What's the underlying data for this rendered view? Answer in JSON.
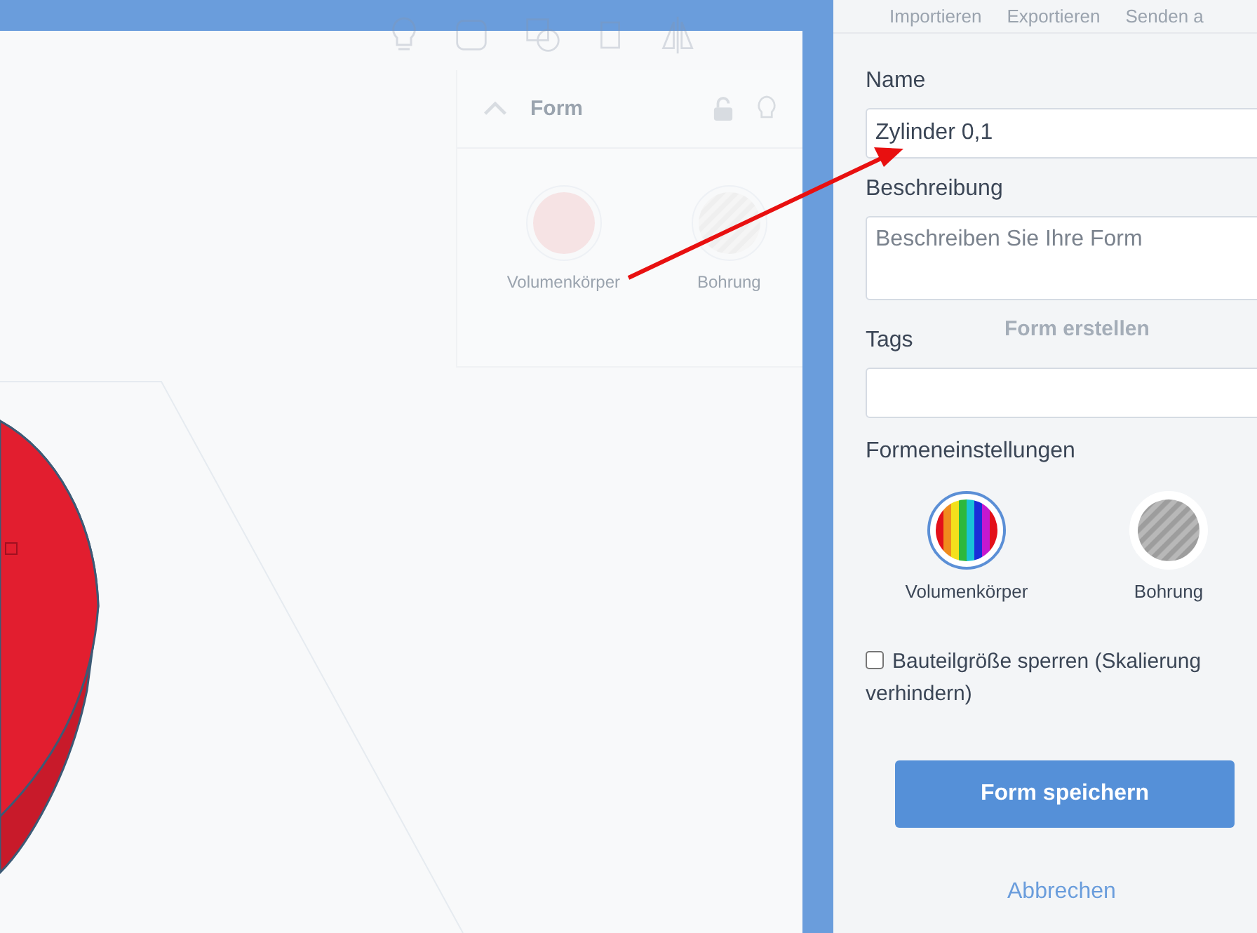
{
  "top_menu": [
    "Importieren",
    "Exportieren",
    "Senden a"
  ],
  "shape_panel": {
    "title": "Form",
    "shape_types": [
      {
        "label": "Volumenkörper",
        "kind": "solid"
      },
      {
        "label": "Bohrung",
        "kind": "hole"
      }
    ]
  },
  "background_button": "Form erstellen",
  "dialog": {
    "name": {
      "label": "Name",
      "value": "Zylinder 0,1"
    },
    "description": {
      "label": "Beschreibung",
      "placeholder": "Beschreiben Sie Ihre Form"
    },
    "tags": {
      "label": "Tags"
    },
    "shape_settings": {
      "label": "Formeneinstellungen",
      "options": [
        {
          "label": "Volumenkörper",
          "kind": "solid",
          "selected": true
        },
        {
          "label": "Bohrung",
          "kind": "hole",
          "selected": false
        }
      ]
    },
    "lock_size": {
      "label": "Bauteilgröße sperren (Skalierung verhindern)",
      "checked": false
    },
    "save_button": "Form speichern",
    "cancel_link": "Abbrechen"
  }
}
